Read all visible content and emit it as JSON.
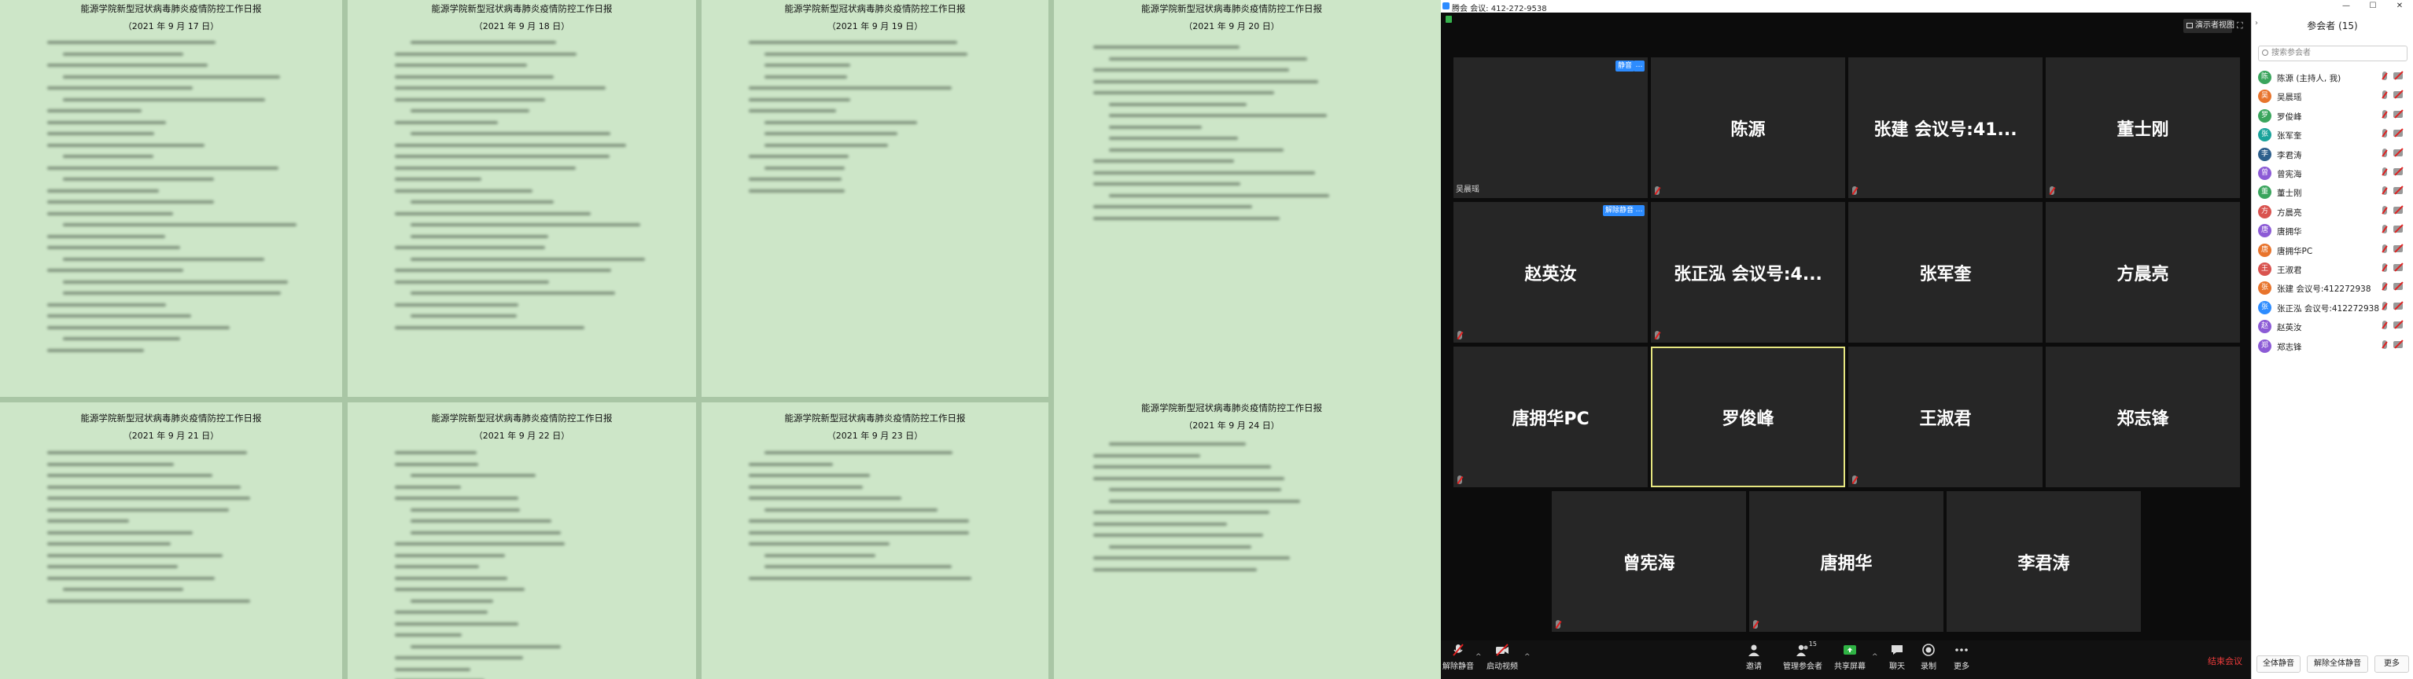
{
  "documents": {
    "pages": [
      {
        "title": "能源学院新型冠状病毒肺炎疫情防控工作日报",
        "date": "（2021 年 9 月 17 日）"
      },
      {
        "title": "能源学院新型冠状病毒肺炎疫情防控工作日报",
        "date": "（2021 年 9 月 18 日）"
      },
      {
        "title": "能源学院新型冠状病毒肺炎疫情防控工作日报",
        "date": "（2021 年 9 月 19 日）"
      },
      {
        "title": "能源学院新型冠状病毒肺炎疫情防控工作日报",
        "date": "（2021 年 9 月 20 日）"
      },
      {
        "title": "能源学院新型冠状病毒肺炎疫情防控工作日报",
        "date": "（2021 年 9 月 21 日）"
      },
      {
        "title": "能源学院新型冠状病毒肺炎疫情防控工作日报",
        "date": "（2021 年 9 月 22 日）"
      },
      {
        "title": "能源学院新型冠状病毒肺炎疫情防控工作日报",
        "date": "（2021 年 9 月 23 日）"
      },
      {
        "title": "能源学院新型冠状病毒肺炎疫情防控工作日报",
        "date": "（2021 年 9 月 24 日）"
      }
    ]
  },
  "meeting": {
    "window_title": "腾会 会议: 412-272-9538",
    "view_button": "演示者视图",
    "top_left_tile_name": "吴晨瑶",
    "badges": {
      "unmute": "静音",
      "unmute_all": "解除静音"
    },
    "tiles": [
      "陈源",
      "张建  会议号:41...",
      "董士刚",
      "赵英汝",
      "张正泓  会议号:4...",
      "张军奎",
      "方晨亮",
      "唐拥华PC",
      "罗俊峰",
      "王淑君",
      "郑志锋",
      "曾宪海",
      "唐拥华",
      "李君涛"
    ],
    "toolbar": {
      "unmute": "解除静音",
      "start_video": "启动视频",
      "invite": "邀请",
      "participants": "管理参会者",
      "participants_count": "15",
      "share": "共享屏幕",
      "chat": "聊天",
      "record": "录制",
      "more": "更多",
      "end": "结束会议"
    }
  },
  "participants_panel": {
    "title": "参会者 (15)",
    "search_placeholder": "搜索参会者",
    "participants": [
      {
        "name": "陈源 (主持人, 我)",
        "avatar": "陈",
        "color": "#3aa55d"
      },
      {
        "name": "吴晨瑶",
        "avatar": "吴",
        "color": "#e8742c"
      },
      {
        "name": "罗俊峰",
        "avatar": "罗",
        "color": "#3aa55d"
      },
      {
        "name": "张军奎",
        "avatar": "张",
        "color": "#1aa39b"
      },
      {
        "name": "李君涛",
        "avatar": "李",
        "color": "#2d5f8c"
      },
      {
        "name": "曾宪海",
        "avatar": "曾",
        "color": "#8c5bd6"
      },
      {
        "name": "董士刚",
        "avatar": "董",
        "color": "#3aa55d"
      },
      {
        "name": "方晨亮",
        "avatar": "方",
        "color": "#d9534f"
      },
      {
        "name": "唐拥华",
        "avatar": "唐",
        "color": "#8c5bd6"
      },
      {
        "name": "唐拥华PC",
        "avatar": "唐",
        "color": "#e8742c"
      },
      {
        "name": "王淑君",
        "avatar": "王",
        "color": "#d9534f"
      },
      {
        "name": "张建  会议号:412272938",
        "avatar": "张",
        "color": "#e8742c"
      },
      {
        "name": "张正泓  会议号:412272938",
        "avatar": "张",
        "color": "#2d8cff"
      },
      {
        "name": "赵英汝",
        "avatar": "赵",
        "color": "#8c5bd6"
      },
      {
        "name": "郑志锋",
        "avatar": "郑",
        "color": "#8c5bd6"
      }
    ],
    "mute_all": "全体静音",
    "unmute_all": "解除全体静音",
    "more": "更多"
  }
}
